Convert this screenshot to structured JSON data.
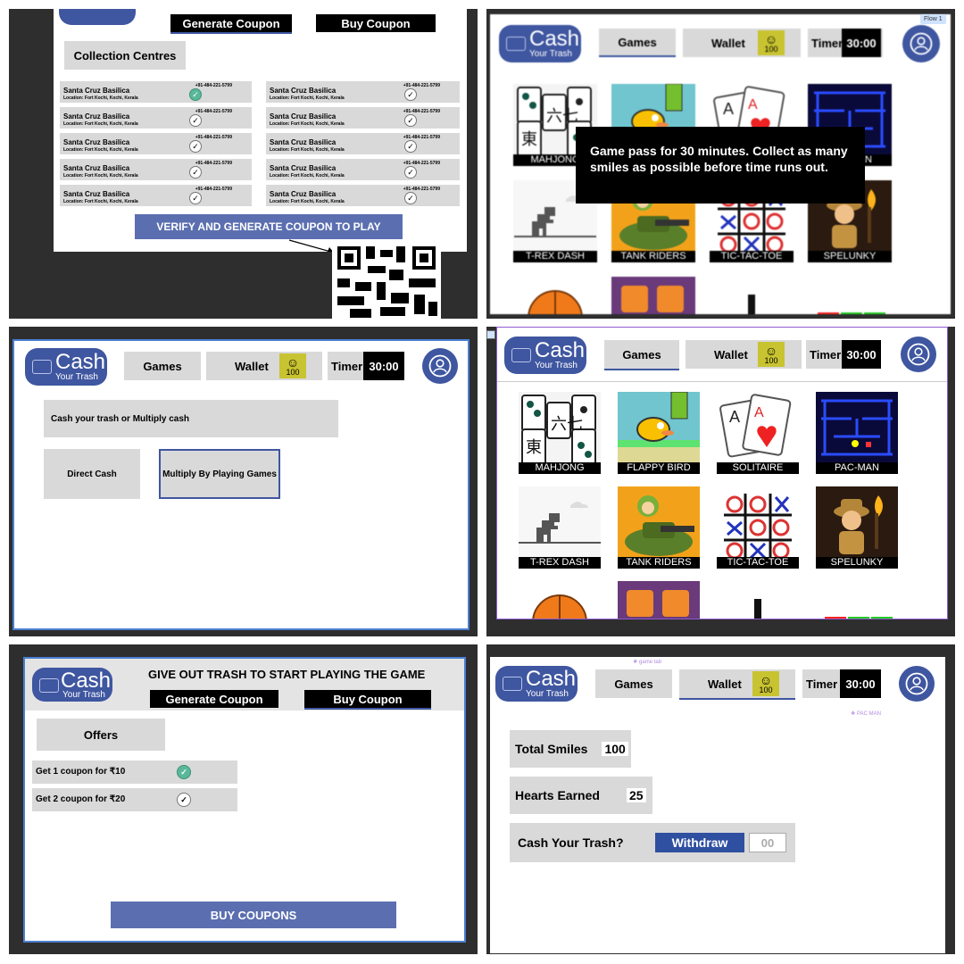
{
  "brand": {
    "logo_main": "Cash",
    "logo_sub": "Your Trash"
  },
  "nav": {
    "games": "Games",
    "wallet": "Wallet",
    "timer": "Timer",
    "timer_value": "30:00",
    "smile_count": "100"
  },
  "panel_collection": {
    "tab_generate": "Generate Coupon",
    "tab_buy": "Buy Coupon",
    "heading": "Collection Centres",
    "centres": [
      {
        "name": "Santa Cruz Basilica",
        "location": "Location: Fort Kochi, Kochi, Kerala",
        "phone": "+91-484-221-5799",
        "selected": true
      },
      {
        "name": "Santa Cruz Basilica",
        "location": "Location: Fort Kochi, Kochi, Kerala",
        "phone": "+91-484-221-5799",
        "selected": false
      },
      {
        "name": "Santa Cruz Basilica",
        "location": "Location: Fort Kochi, Kochi, Kerala",
        "phone": "+91-484-221-5799",
        "selected": false
      },
      {
        "name": "Santa Cruz Basilica",
        "location": "Location: Fort Kochi, Kochi, Kerala",
        "phone": "+91-484-221-5799",
        "selected": false
      },
      {
        "name": "Santa Cruz Basilica",
        "location": "Location: Fort Kochi, Kochi, Kerala",
        "phone": "+91-484-221-5799",
        "selected": false
      },
      {
        "name": "Santa Cruz Basilica",
        "location": "Location: Fort Kochi, Kochi, Kerala",
        "phone": "+91-484-221-5799",
        "selected": false
      },
      {
        "name": "Santa Cruz Basilica",
        "location": "Location: Fort Kochi, Kochi, Kerala",
        "phone": "+91-484-221-5799",
        "selected": false
      },
      {
        "name": "Santa Cruz Basilica",
        "location": "Location: Fort Kochi, Kochi, Kerala",
        "phone": "+91-484-221-5799",
        "selected": false
      },
      {
        "name": "Santa Cruz Basilica",
        "location": "Location: Fort Kochi, Kochi, Kerala",
        "phone": "+91-484-221-5799",
        "selected": false
      },
      {
        "name": "Santa Cruz Basilica",
        "location": "Location: Fort Kochi, Kochi, Kerala",
        "phone": "+91-484-221-5799",
        "selected": false
      }
    ],
    "verify_button": "VERIFY AND GENERATE COUPON TO PLAY"
  },
  "panel_modal": {
    "flow_tag": "Flow 1",
    "message": "Game pass for 30 minutes. Collect as many smiles as possible before time runs out."
  },
  "panel_choice": {
    "prompt": "Cash your trash or Multiply cash",
    "direct": "Direct Cash",
    "multiply": "Multiply By Playing Games"
  },
  "games": [
    {
      "name": "MAHJONG",
      "icon": "mahjong-tiles",
      "bg": "#f4f4f4"
    },
    {
      "name": "FLAPPY BIRD",
      "icon": "flappy-bird",
      "bg": "#70c5ce"
    },
    {
      "name": "SOLITAIRE",
      "icon": "playing-cards",
      "bg": "#ffffff"
    },
    {
      "name": "PAC-MAN",
      "icon": "pac-maze",
      "bg": "#0a0a3a"
    },
    {
      "name": "T-REX DASH",
      "icon": "dino",
      "bg": "#f7f7f7"
    },
    {
      "name": "TANK RIDERS",
      "icon": "tank",
      "bg": "#f2a21a"
    },
    {
      "name": "TIC-TAC-TOE",
      "icon": "tictactoe-grid",
      "bg": "#ffffff"
    },
    {
      "name": "SPELUNKY",
      "icon": "explorer",
      "bg": "#2a1a10"
    }
  ],
  "panel_offers": {
    "headline": "GIVE OUT TRASH TO START PLAYING THE GAME",
    "tab_generate": "Generate Coupon",
    "tab_buy": "Buy Coupon",
    "heading": "Offers",
    "offers": [
      {
        "label": "Get 1 coupon for ₹10",
        "selected": true
      },
      {
        "label": "Get 2 coupon for ₹20",
        "selected": false
      }
    ],
    "buy_button": "BUY COUPONS"
  },
  "panel_wallet": {
    "note_game_tab": "❖ game tab",
    "note_pacman": "❖ PAC MAN",
    "total_label": "Total Smiles",
    "total_value": "100",
    "hearts_label": "Hearts Earned",
    "hearts_value": "25",
    "cash_label": "Cash Your Trash?",
    "withdraw": "Withdraw",
    "withdraw_amount": "00"
  },
  "colors": {
    "brand_blue": "#3f56a0",
    "button_blue": "#5b6fb0",
    "smile_yellow": "#c8c330",
    "check_green": "#5ab89a"
  }
}
